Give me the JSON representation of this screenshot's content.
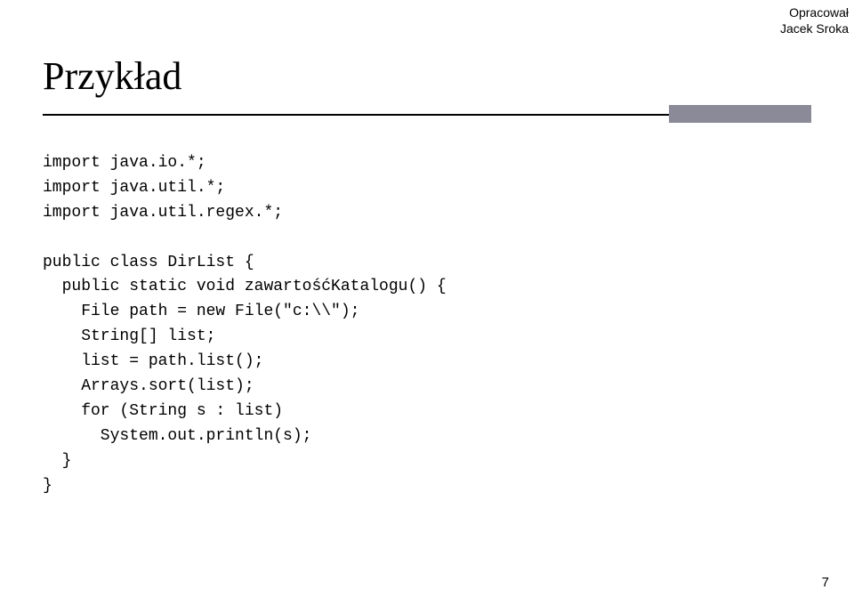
{
  "attribution": {
    "line1": "Opracował",
    "line2": "Jacek Sroka"
  },
  "title": "Przykład",
  "code": {
    "line1": "import java.io.*;",
    "line2": "import java.util.*;",
    "line3": "import java.util.regex.*;",
    "line4": "",
    "line5": "public class DirList {",
    "line6": "  public static void zawartośćKatalogu() {",
    "line7": "    File path = new File(\"c:\\\\\");",
    "line8": "    String[] list;",
    "line9": "    list = path.list();",
    "line10": "    Arrays.sort(list);",
    "line11": "    for (String s : list)",
    "line12": "      System.out.println(s);",
    "line13": "  }",
    "line14": "}"
  },
  "pageNumber": "7"
}
